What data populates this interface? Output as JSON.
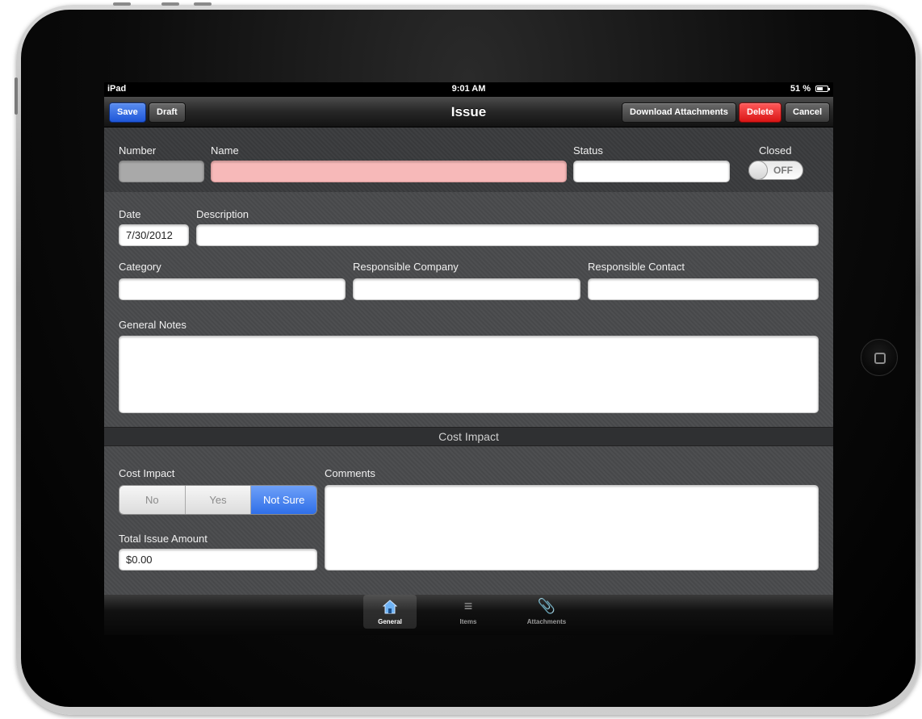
{
  "device": {
    "name": "iPad"
  },
  "status_bar": {
    "carrier": "iPad",
    "time": "9:01 AM",
    "battery": "51 %"
  },
  "nav_bar": {
    "title": "Issue",
    "left_buttons": [
      "Save",
      "Draft"
    ],
    "right_buttons": [
      "Download Attachments",
      "Delete",
      "Cancel"
    ]
  },
  "header_section": {
    "number_label": "Number",
    "number_value": "",
    "name_label": "Name",
    "name_value": "",
    "status_label": "Status",
    "status_value": "",
    "closed_label": "Closed",
    "closed_toggle": "OFF"
  },
  "details_section": {
    "date_label": "Date",
    "date_value": "7/30/2012",
    "description_label": "Description",
    "description_value": "",
    "category_label": "Category",
    "category_value": "",
    "responsible_company_label": "Responsible Company",
    "responsible_company_value": "",
    "responsible_contact_label": "Responsible Contact",
    "responsible_contact_value": "",
    "general_notes_label": "General Notes",
    "general_notes_value": ""
  },
  "cost_section": {
    "header": "Cost Impact",
    "cost_impact_label": "Cost Impact",
    "cost_impact_options": [
      "No",
      "Yes",
      "Not Sure"
    ],
    "cost_impact_selected": "Not Sure",
    "comments_label": "Comments",
    "comments_value": "",
    "total_amount_label": "Total Issue Amount",
    "total_amount_value": "$0.00"
  },
  "tab_bar": {
    "tabs": [
      {
        "label": "General",
        "icon": "home-icon",
        "selected": true
      },
      {
        "label": "Items",
        "icon": "list-icon",
        "selected": false
      },
      {
        "label": "Attachments",
        "icon": "paperclip-icon",
        "selected": false
      }
    ]
  },
  "colors": {
    "accent_blue": "#2f6fe8",
    "delete_red": "#d91414",
    "required_pink": "#f7b9b9"
  }
}
